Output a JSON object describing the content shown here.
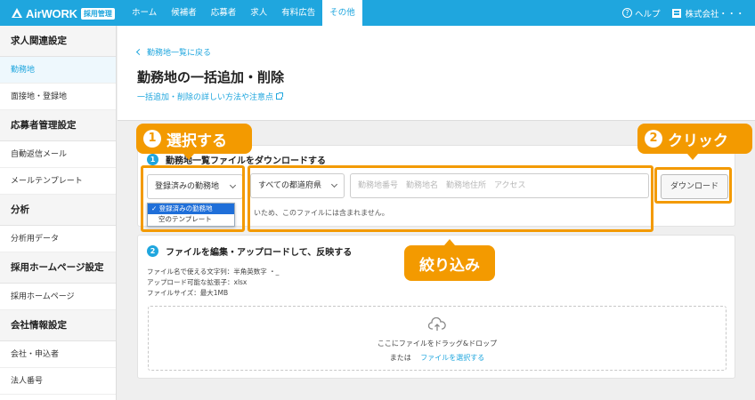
{
  "header": {
    "brand": "AirWORK",
    "badge": "採用管理",
    "nav": [
      "ホーム",
      "候補者",
      "応募者",
      "求人",
      "有料広告",
      "その他"
    ],
    "help": "ヘルプ",
    "company": "株式会社・・・",
    "colors": {
      "primary": "#1fa6de",
      "accent": "#f39a00"
    }
  },
  "sidebar": {
    "groups": [
      {
        "title": "求人関連設定",
        "items": [
          "勤務地",
          "面接地・登録地"
        ]
      },
      {
        "title": "応募者管理設定",
        "items": [
          "自動返信メール",
          "メールテンプレート"
        ]
      },
      {
        "title": "分析",
        "items": [
          "分析用データ"
        ]
      },
      {
        "title": "採用ホームページ設定",
        "items": [
          "採用ホームページ"
        ]
      },
      {
        "title": "会社情報設定",
        "items": [
          "会社・申込者",
          "法人番号"
        ]
      }
    ]
  },
  "page": {
    "back": "勤務地一覧に戻る",
    "title": "勤務地の一括追加・削除",
    "detail_link": "一括追加・削除の詳しい方法や注意点"
  },
  "step1": {
    "num": "1",
    "heading": "勤務地一覧ファイルをダウンロードする",
    "select_type": "登録済みの勤務地",
    "select_pref": "すべての都道府県",
    "search_placeholder": "勤務地番号　勤務地名　勤務地住所　アクセス",
    "download": "ダウンロード",
    "note": "いため、このファイルには含まれません。",
    "dropdown_options": [
      "登録済みの勤務地",
      "空のテンプレート"
    ]
  },
  "step2": {
    "num": "2",
    "heading": "ファイルを編集・アップロードして、反映する",
    "info": [
      "ファイル名で使える文字列：半角英数字 ・_",
      "アップロード可能な拡張子：xlsx",
      "ファイルサイズ：最大1MB"
    ],
    "drop_text": "ここにファイルをドラッグ&ドロップ",
    "or": "または",
    "select_file": "ファイルを選択する"
  },
  "annotations": {
    "select": {
      "num": "1",
      "text": "選択する"
    },
    "click": {
      "num": "2",
      "text": "クリック"
    },
    "filter": {
      "text": "絞り込み"
    }
  }
}
